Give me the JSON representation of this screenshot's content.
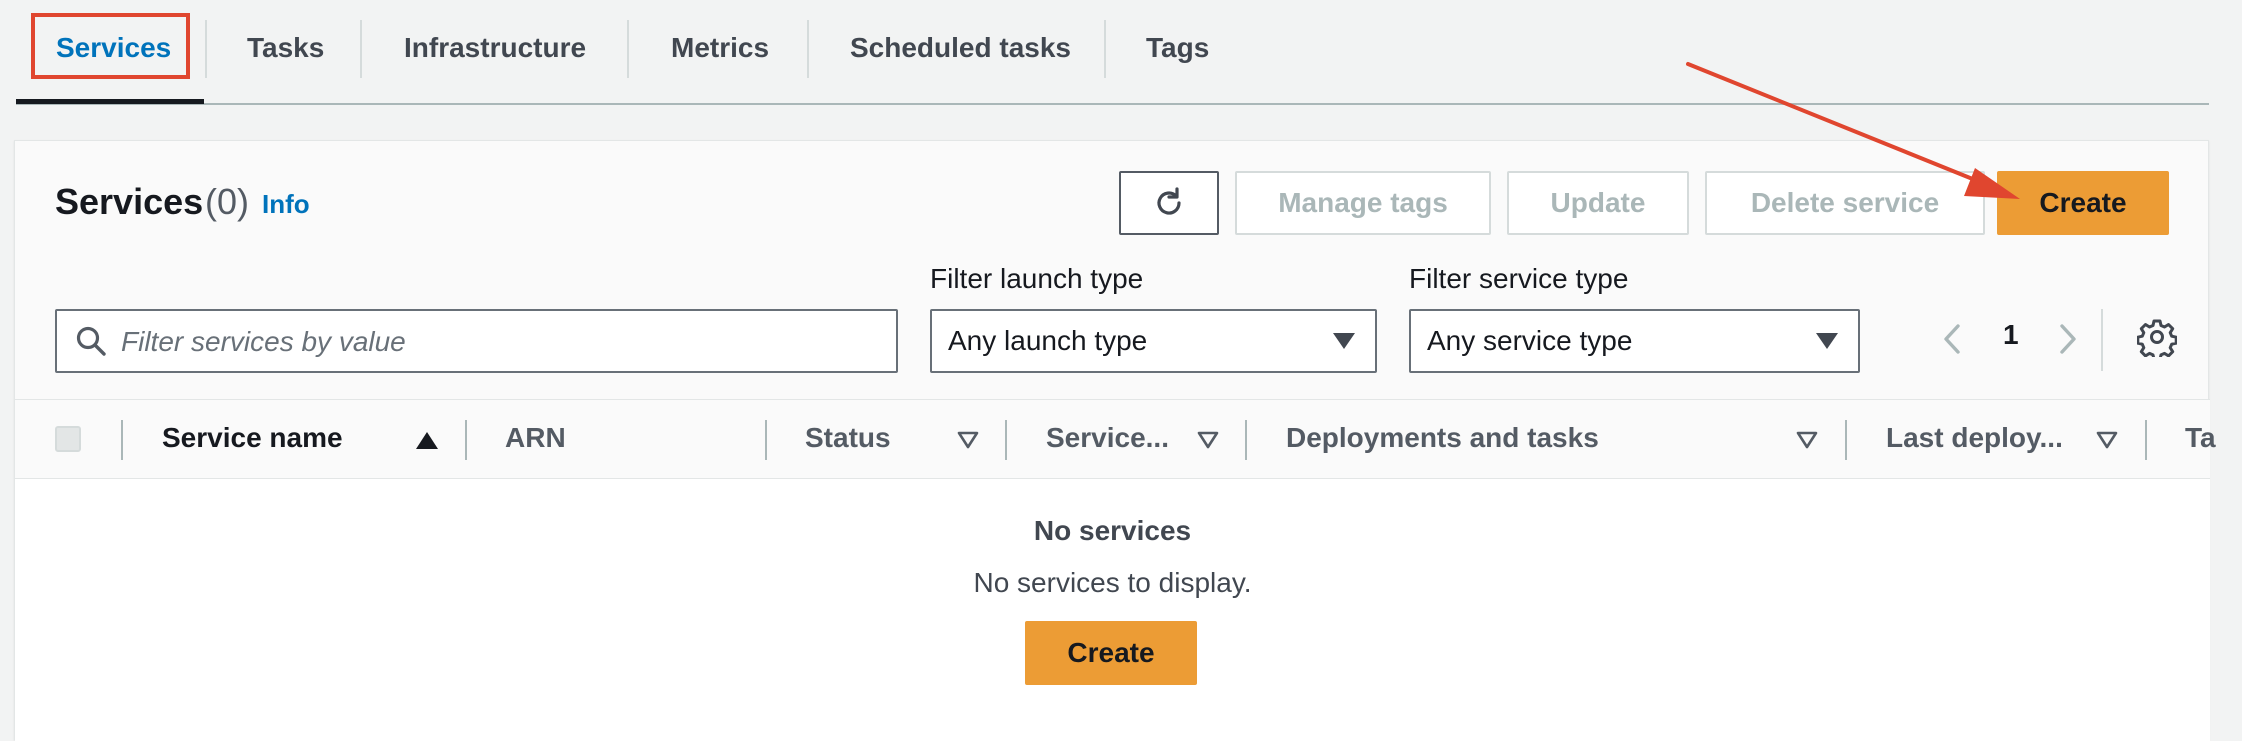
{
  "tabs": [
    {
      "label": "Services",
      "active": true
    },
    {
      "label": "Tasks",
      "active": false
    },
    {
      "label": "Infrastructure",
      "active": false
    },
    {
      "label": "Metrics",
      "active": false
    },
    {
      "label": "Scheduled tasks",
      "active": false
    },
    {
      "label": "Tags",
      "active": false
    }
  ],
  "panel": {
    "title": "Services",
    "count": "(0)",
    "info_link": "Info"
  },
  "actions": {
    "refresh_icon": "refresh-icon",
    "manage_tags": "Manage tags",
    "update": "Update",
    "delete_service": "Delete service",
    "create": "Create"
  },
  "filters": {
    "search_placeholder": "Filter services by value",
    "launch_type_label": "Filter launch type",
    "launch_type_value": "Any launch type",
    "service_type_label": "Filter service type",
    "service_type_value": "Any service type"
  },
  "pagination": {
    "current_page": "1"
  },
  "table": {
    "columns": [
      {
        "label": "Service name",
        "sort": "ascending"
      },
      {
        "label": "ARN",
        "sort": "none"
      },
      {
        "label": "Status",
        "sort": "sortable"
      },
      {
        "label": "Service...",
        "sort": "sortable"
      },
      {
        "label": "Deployments and tasks",
        "sort": "sortable"
      },
      {
        "label": "Last deploy...",
        "sort": "sortable"
      },
      {
        "label": "Ta",
        "sort": "none"
      }
    ],
    "empty_title": "No services",
    "empty_description": "No services to display.",
    "empty_create": "Create"
  },
  "colors": {
    "accent_blue": "#0073bb",
    "primary_orange": "#ec9c35",
    "annotation_red": "#e0462f"
  }
}
